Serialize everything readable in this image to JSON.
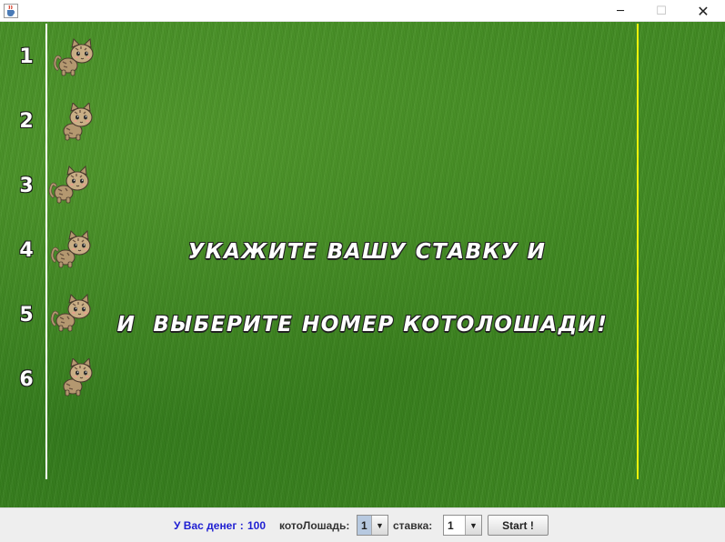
{
  "window": {
    "icons": {
      "app": "java-cup-icon",
      "minimize": "minimize-icon",
      "maximize": "maximize-icon",
      "close": "close-icon"
    },
    "glyphs": {
      "minimize": "─",
      "maximize": "☐",
      "close": "✕"
    }
  },
  "field": {
    "grass_color": "#3f8a22",
    "start_line_color": "#ffffff",
    "finish_line_color": "#f2f20a",
    "lanes": [
      {
        "number": "1",
        "cat_icon": "cat-icon",
        "facing": "right"
      },
      {
        "number": "2",
        "cat_icon": "cat-icon",
        "facing": "front"
      },
      {
        "number": "3",
        "cat_icon": "cat-icon",
        "facing": "right"
      },
      {
        "number": "4",
        "cat_icon": "cat-icon",
        "facing": "right"
      },
      {
        "number": "5",
        "cat_icon": "cat-icon",
        "facing": "right"
      },
      {
        "number": "6",
        "cat_icon": "cat-icon",
        "facing": "front"
      }
    ],
    "message_line1": "УКАЖИТЕ ВАШУ СТАВКУ И",
    "message_line2": "И  ВЫБЕРИТЕ НОМЕР КОТОЛОШАДИ!"
  },
  "controls": {
    "money_label": "У Вас денег :",
    "money_value": "100",
    "horse_label": "котоЛошадь:",
    "horse_selected": "1",
    "bet_label": "ставка:",
    "bet_selected": "1",
    "start_label": "Start !",
    "money_color": "#1e1ed2",
    "combo_arrow": "chevron-down-icon"
  }
}
